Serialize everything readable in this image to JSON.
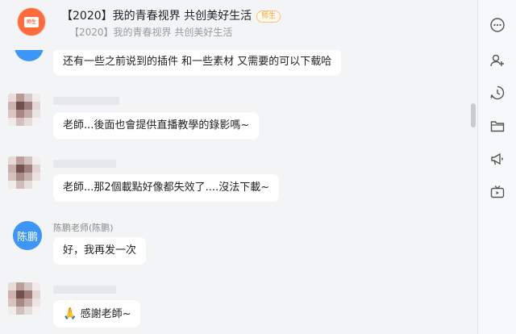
{
  "header": {
    "title": "【2020】我的青春视界 共创美好生活",
    "tag": "师生",
    "subtitle": "【2020】我的青春视界 共创美好生活",
    "avatar_label": "师生"
  },
  "messages": [
    {
      "text": "还有一些之前说到的插件 和一些素材 又需要的可以下载哈"
    },
    {
      "text": "老師...後面也會提供直播教學的錄影嗎~"
    },
    {
      "text": "老師...那2個載點好像都失效了....沒法下載~"
    },
    {
      "sender": "陈鹏老师(陈鹏)",
      "avatar_label": "陈鹏",
      "text": "好，我再发一次"
    },
    {
      "emoji": "🙏",
      "text": "感謝老師~"
    }
  ],
  "toolbar": {
    "icons": [
      "more-icon",
      "add-member-icon",
      "history-icon",
      "folder-icon",
      "announcement-icon",
      "live-icon"
    ]
  },
  "colors": {
    "accent_blue": "#3d95f6",
    "group_avatar": "#ff6b3d"
  }
}
